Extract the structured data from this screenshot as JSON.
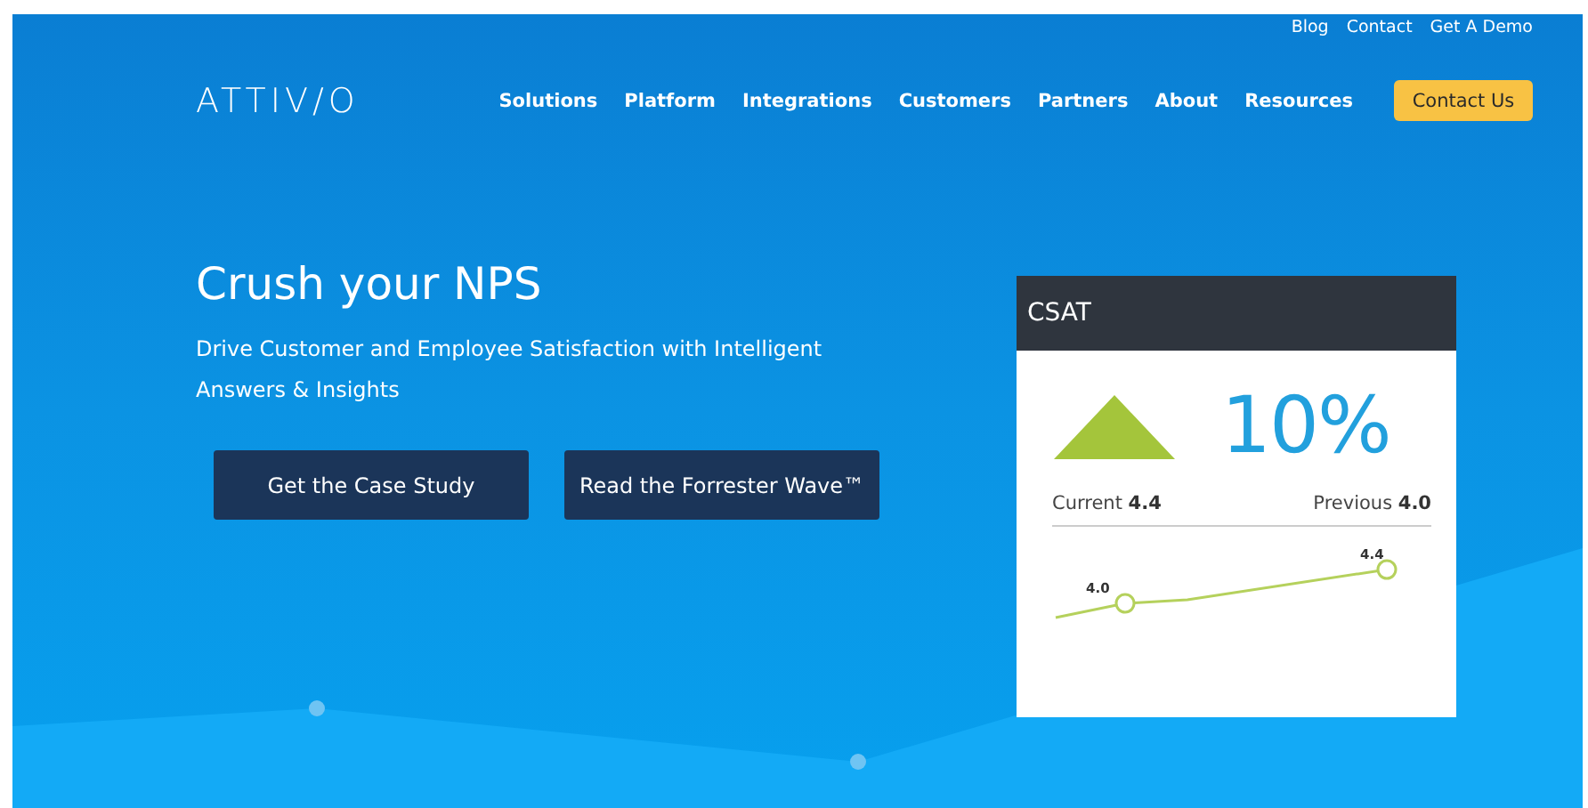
{
  "top_links": [
    "Blog",
    "Contact",
    "Get A Demo"
  ],
  "logo": "ATTIV/O",
  "nav": [
    "Solutions",
    "Platform",
    "Integrations",
    "Customers",
    "Partners",
    "About",
    "Resources"
  ],
  "nav_button": "Contact Us",
  "hero": {
    "title": "Crush your NPS",
    "subtitle": "Drive Customer and Employee Satisfaction with Intelligent Answers & Insights",
    "buttons": [
      "Get the Case Study",
      "Read the Forrester Wave™"
    ]
  },
  "card": {
    "title": "CSAT",
    "change": "10%",
    "current_label": "Current",
    "current_value": "4.4",
    "previous_label": "Previous",
    "previous_value": "4.0",
    "sparkline_start": "4.0",
    "sparkline_end": "4.4"
  }
}
